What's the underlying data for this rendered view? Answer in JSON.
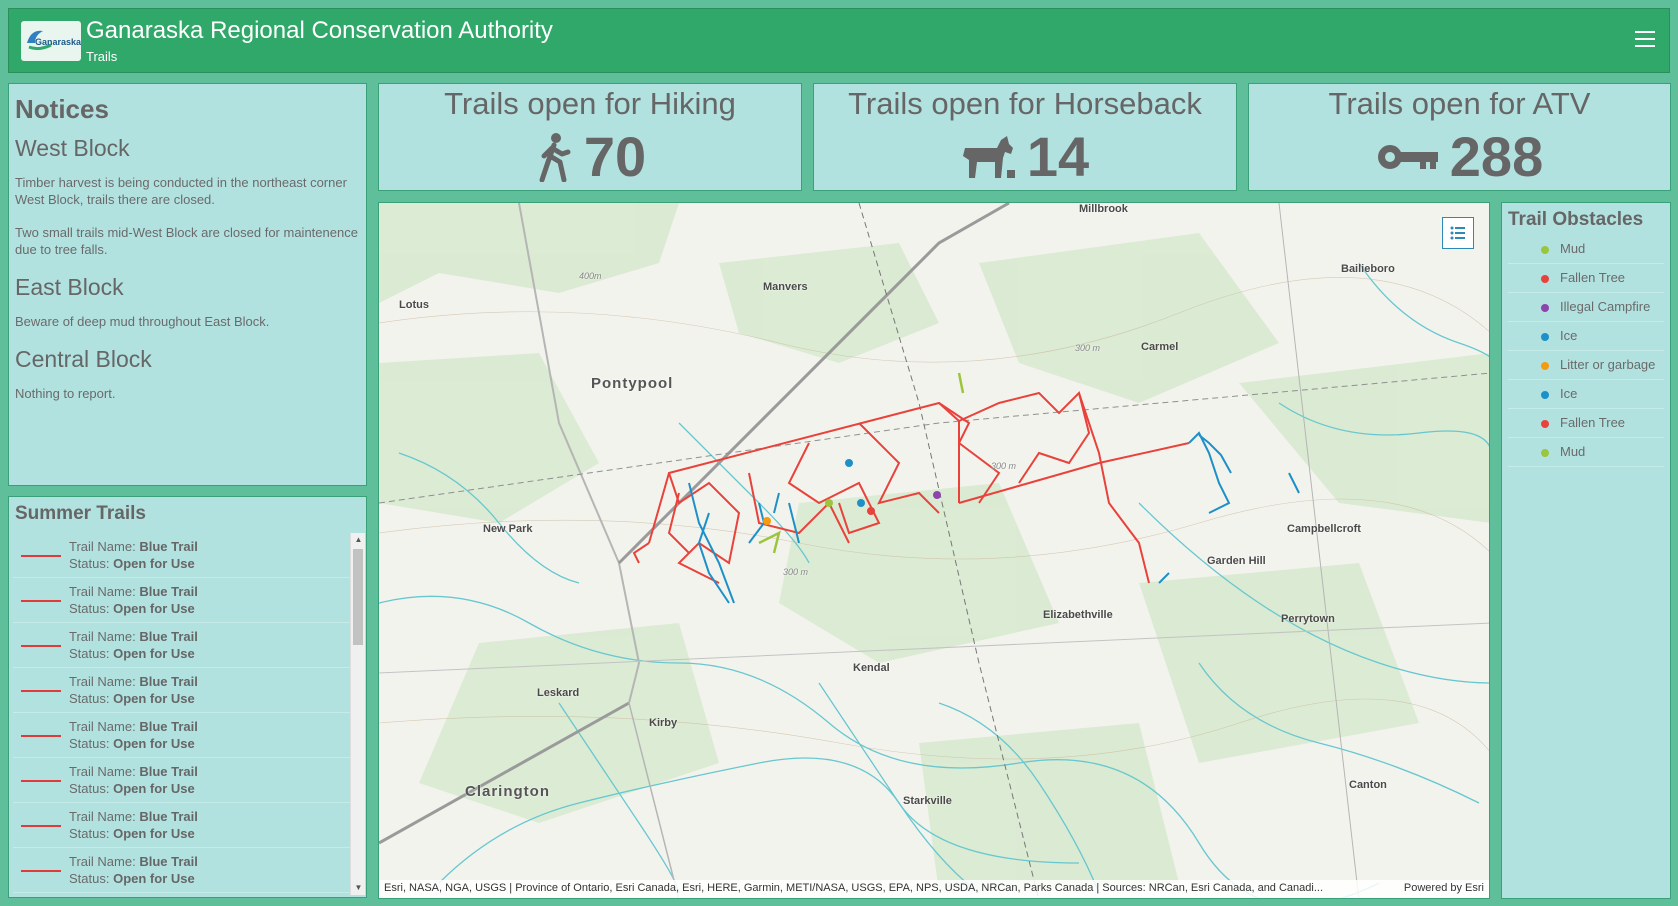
{
  "header": {
    "title": "Ganaraska Regional Conservation Authority",
    "subtitle": "Trails",
    "logo_text": "Ganaraska"
  },
  "notices": {
    "heading": "Notices",
    "west_block": {
      "title": "West Block",
      "lines": [
        "Timber harvest is being conducted in the northeast corner West Block, trails there are closed.",
        "Two small trails mid-West Block are closed for maintenence due to tree falls."
      ]
    },
    "east_block": {
      "title": "East Block",
      "lines": [
        "Beware of deep mud throughout East Block."
      ]
    },
    "central_block": {
      "title": "Central Block",
      "lines": [
        "Nothing to report."
      ]
    }
  },
  "stats": {
    "hiking": {
      "title": "Trails open for Hiking",
      "value": "70",
      "icon": "hiking-icon"
    },
    "horseback": {
      "title": "Trails open for Horseback",
      "value": "14",
      "icon": "horse-icon"
    },
    "atv": {
      "title": "Trails open for ATV",
      "value": "288",
      "icon": "key-icon"
    }
  },
  "summer_trails": {
    "title": "Summer Trails",
    "name_label": "Trail Name:",
    "status_label": "Status:",
    "items": [
      {
        "name": "Blue Trail",
        "status": "Open for Use"
      },
      {
        "name": "Blue Trail",
        "status": "Open for Use"
      },
      {
        "name": "Blue Trail",
        "status": "Open for Use"
      },
      {
        "name": "Blue Trail",
        "status": "Open for Use"
      },
      {
        "name": "Blue Trail",
        "status": "Open for Use"
      },
      {
        "name": "Blue Trail",
        "status": "Open for Use"
      },
      {
        "name": "Blue Trail",
        "status": "Open for Use"
      },
      {
        "name": "Blue Trail",
        "status": "Open for Use"
      }
    ]
  },
  "map": {
    "labels": [
      "Millbrook",
      "Manvers",
      "Lotus",
      "Pontypool",
      "Carmel",
      "Bailieboro",
      "New Park",
      "Campbellcroft",
      "Garden Hill",
      "Elizabethville",
      "Perrytown",
      "Kendal",
      "Leskard",
      "Kirby",
      "Clarington",
      "Starkville",
      "Canton",
      "400m",
      "300 m",
      "300 m",
      "300 m"
    ],
    "attribution": "Esri, NASA, NGA, USGS | Province of Ontario, Esri Canada, Esri, HERE, Garmin, METI/NASA, USGS, EPA, NPS, USDA, NRCan, Parks Canada | Sources: NRCan, Esri Canada, and Canadi...",
    "powered_by": "Powered by Esri",
    "trail_colors": {
      "red": "#e8423b",
      "blue": "#1e90c8",
      "green": "#9bc53d"
    }
  },
  "obstacles": {
    "title": "Trail Obstacles",
    "items": [
      {
        "label": "Mud",
        "color": "#9bc53d"
      },
      {
        "label": "Fallen Tree",
        "color": "#e8423b"
      },
      {
        "label": "Illegal Campfire",
        "color": "#8e44ad"
      },
      {
        "label": "Ice",
        "color": "#1e90c8"
      },
      {
        "label": "Litter or garbage",
        "color": "#f39c12"
      },
      {
        "label": "Ice",
        "color": "#1e90c8"
      },
      {
        "label": "Fallen Tree",
        "color": "#e8423b"
      },
      {
        "label": "Mud",
        "color": "#9bc53d"
      }
    ]
  }
}
